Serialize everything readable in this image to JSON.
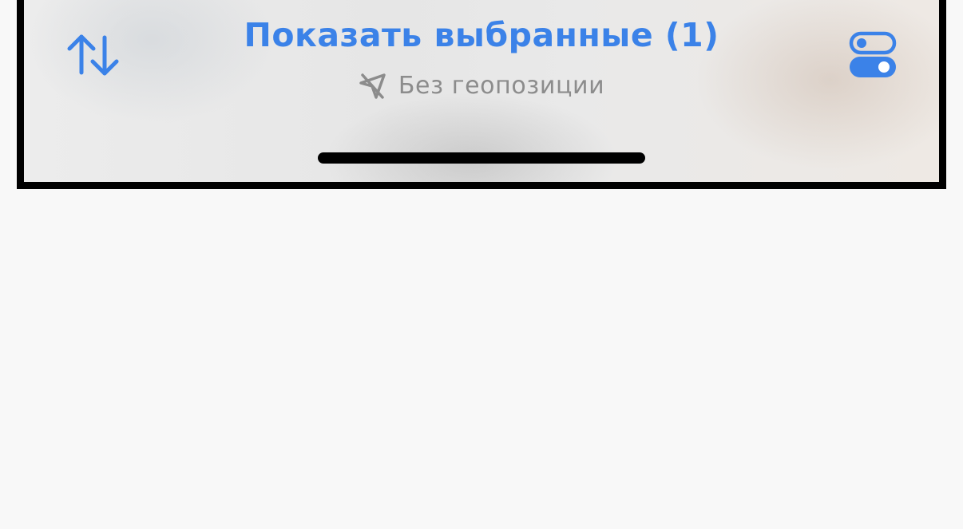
{
  "toolbar": {
    "title": "Показать выбранные (1)",
    "subtitle": "Без геопозиции",
    "sort_icon": "arrow-up-down-icon",
    "location_icon": "location-slash-icon",
    "filter_icon": "toggles-icon"
  },
  "colors": {
    "accent": "#3b82e8",
    "subtitle": "#8c8c8c",
    "background": "#f8f8f8"
  }
}
